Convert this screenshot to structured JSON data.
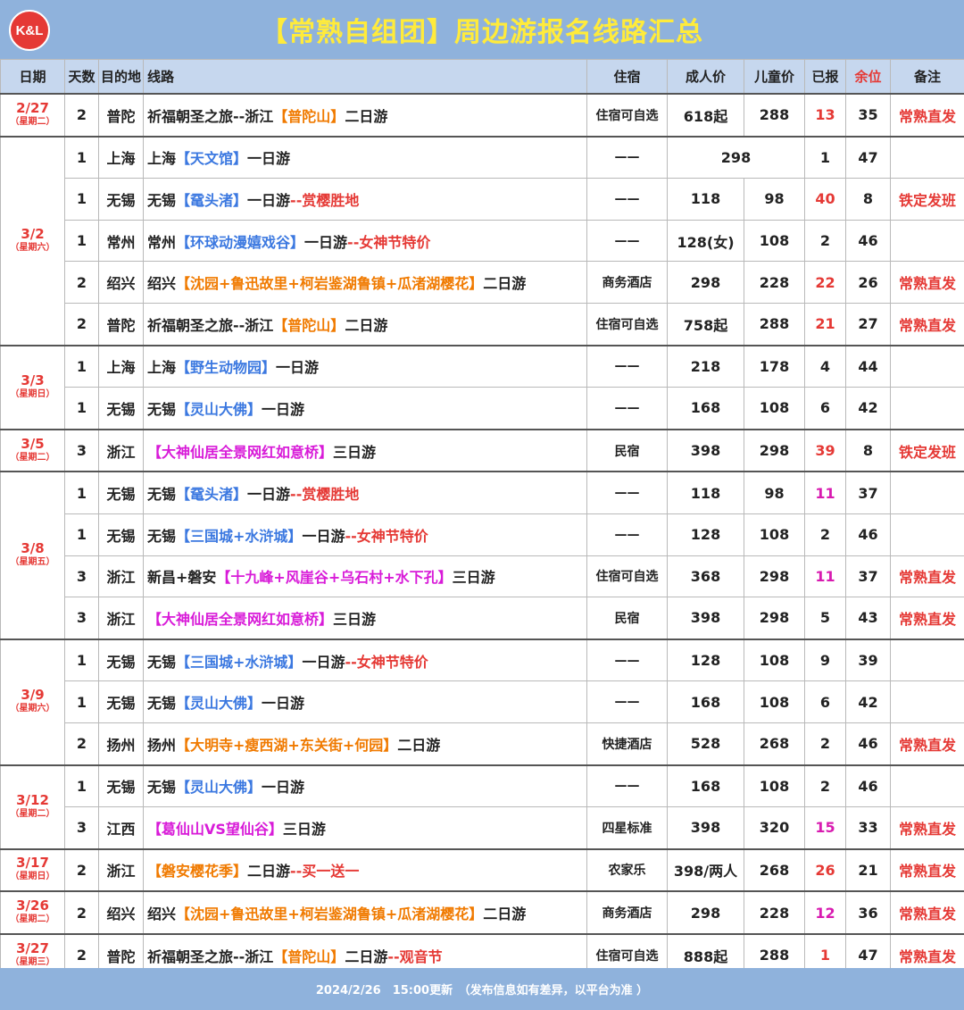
{
  "header": {
    "logo": "K&L",
    "title": "【常熟自组团】周边游报名线路汇总"
  },
  "columns": [
    "日期",
    "天数",
    "目的地",
    "线路",
    "住宿",
    "成人价",
    "儿童价",
    "已报",
    "余位",
    "备注"
  ],
  "groups": [
    {
      "date": "2/27",
      "weekday": "（星期二）",
      "rows": [
        {
          "days": "2",
          "dest": "普陀",
          "route": [
            [
              "d",
              "祈福朝圣之旅--浙江"
            ],
            [
              "o",
              "【普陀山】"
            ],
            [
              "d",
              "二日游"
            ]
          ],
          "lodging": "住宿可自选",
          "adult": "618起",
          "child": "288",
          "reported": "13",
          "rep_color": "red",
          "remain": "35",
          "note": "常熟直发"
        }
      ]
    },
    {
      "date": "3/2",
      "weekday": "（星期六）",
      "rows": [
        {
          "days": "1",
          "dest": "上海",
          "route": [
            [
              "d",
              "上海"
            ],
            [
              "b",
              "【天文馆】"
            ],
            [
              "d",
              "一日游"
            ]
          ],
          "lodging": "——",
          "adult": "298",
          "child": "",
          "merged_price": true,
          "reported": "1",
          "rep_color": "",
          "remain": "47",
          "note": ""
        },
        {
          "days": "1",
          "dest": "无锡",
          "route": [
            [
              "d",
              "无锡"
            ],
            [
              "b",
              "【鼋头渚】"
            ],
            [
              "d",
              "一日游"
            ],
            [
              "r",
              "--赏樱胜地"
            ]
          ],
          "lodging": "——",
          "adult": "118",
          "child": "98",
          "reported": "40",
          "rep_color": "red",
          "remain": "8",
          "note": "铁定发班"
        },
        {
          "days": "1",
          "dest": "常州",
          "route": [
            [
              "d",
              "常州"
            ],
            [
              "b",
              "【环球动漫嬉戏谷】"
            ],
            [
              "d",
              "一日游"
            ],
            [
              "r",
              "--女神节特价"
            ]
          ],
          "lodging": "——",
          "adult": "128(女)",
          "child": "108",
          "reported": "2",
          "rep_color": "",
          "remain": "46",
          "note": ""
        },
        {
          "days": "2",
          "dest": "绍兴",
          "route": [
            [
              "d",
              "绍兴"
            ],
            [
              "o",
              "【沈园+鲁迅故里+柯岩鉴湖鲁镇+瓜渚湖樱花】"
            ],
            [
              "d",
              "二日游"
            ]
          ],
          "lodging": "商务酒店",
          "adult": "298",
          "child": "228",
          "reported": "22",
          "rep_color": "red",
          "remain": "26",
          "note": "常熟直发"
        },
        {
          "days": "2",
          "dest": "普陀",
          "route": [
            [
              "d",
              "祈福朝圣之旅--浙江"
            ],
            [
              "o",
              "【普陀山】"
            ],
            [
              "d",
              "二日游"
            ]
          ],
          "lodging": "住宿可自选",
          "adult": "758起",
          "child": "288",
          "reported": "21",
          "rep_color": "red",
          "remain": "27",
          "note": "常熟直发"
        }
      ]
    },
    {
      "date": "3/3",
      "weekday": "（星期日）",
      "rows": [
        {
          "days": "1",
          "dest": "上海",
          "route": [
            [
              "d",
              "上海"
            ],
            [
              "b",
              "【野生动物园】"
            ],
            [
              "d",
              "一日游"
            ]
          ],
          "lodging": "——",
          "adult": "218",
          "child": "178",
          "reported": "4",
          "rep_color": "",
          "remain": "44",
          "note": ""
        },
        {
          "days": "1",
          "dest": "无锡",
          "route": [
            [
              "d",
              "无锡"
            ],
            [
              "b",
              "【灵山大佛】"
            ],
            [
              "d",
              "一日游"
            ]
          ],
          "lodging": "——",
          "adult": "168",
          "child": "108",
          "reported": "6",
          "rep_color": "",
          "remain": "42",
          "note": ""
        }
      ]
    },
    {
      "date": "3/5",
      "weekday": "（星期二）",
      "rows": [
        {
          "days": "3",
          "dest": "浙江",
          "route": [
            [
              "m",
              "【大神仙居全景网红如意桥】"
            ],
            [
              "d",
              "三日游"
            ]
          ],
          "lodging": "民宿",
          "adult": "398",
          "child": "298",
          "reported": "39",
          "rep_color": "red",
          "remain": "8",
          "note": "铁定发班"
        }
      ]
    },
    {
      "date": "3/8",
      "weekday": "（星期五）",
      "rows": [
        {
          "days": "1",
          "dest": "无锡",
          "route": [
            [
              "d",
              "无锡"
            ],
            [
              "b",
              "【鼋头渚】"
            ],
            [
              "d",
              "一日游"
            ],
            [
              "r",
              "--赏樱胜地"
            ]
          ],
          "lodging": "——",
          "adult": "118",
          "child": "98",
          "reported": "11",
          "rep_color": "magenta",
          "remain": "37",
          "note": ""
        },
        {
          "days": "1",
          "dest": "无锡",
          "route": [
            [
              "d",
              "无锡"
            ],
            [
              "b",
              "【三国城+水浒城】"
            ],
            [
              "d",
              "一日游"
            ],
            [
              "r",
              "--女神节特价"
            ]
          ],
          "lodging": "——",
          "adult": "128",
          "child": "108",
          "reported": "2",
          "rep_color": "",
          "remain": "46",
          "note": ""
        },
        {
          "days": "3",
          "dest": "浙江",
          "route": [
            [
              "d",
              "新昌+磐安"
            ],
            [
              "m",
              "【十九峰+风崖谷+乌石村+水下孔】"
            ],
            [
              "d",
              "三日游"
            ]
          ],
          "lodging": "住宿可自选",
          "adult": "368",
          "child": "298",
          "reported": "11",
          "rep_color": "magenta",
          "remain": "37",
          "note": "常熟直发"
        },
        {
          "days": "3",
          "dest": "浙江",
          "route": [
            [
              "m",
              "【大神仙居全景网红如意桥】"
            ],
            [
              "d",
              "三日游"
            ]
          ],
          "lodging": "民宿",
          "adult": "398",
          "child": "298",
          "reported": "5",
          "rep_color": "",
          "remain": "43",
          "note": "常熟直发"
        }
      ]
    },
    {
      "date": "3/9",
      "weekday": "（星期六）",
      "rows": [
        {
          "days": "1",
          "dest": "无锡",
          "route": [
            [
              "d",
              "无锡"
            ],
            [
              "b",
              "【三国城+水浒城】"
            ],
            [
              "d",
              "一日游"
            ],
            [
              "r",
              "--女神节特价"
            ]
          ],
          "lodging": "——",
          "adult": "128",
          "child": "108",
          "reported": "9",
          "rep_color": "",
          "remain": "39",
          "note": ""
        },
        {
          "days": "1",
          "dest": "无锡",
          "route": [
            [
              "d",
              "无锡"
            ],
            [
              "b",
              "【灵山大佛】"
            ],
            [
              "d",
              "一日游"
            ]
          ],
          "lodging": "——",
          "adult": "168",
          "child": "108",
          "reported": "6",
          "rep_color": "",
          "remain": "42",
          "note": ""
        },
        {
          "days": "2",
          "dest": "扬州",
          "route": [
            [
              "d",
              "扬州"
            ],
            [
              "o",
              "【大明寺+瘦西湖+东关街+何园】"
            ],
            [
              "d",
              "二日游"
            ]
          ],
          "lodging": "快捷酒店",
          "adult": "528",
          "child": "268",
          "reported": "2",
          "rep_color": "",
          "remain": "46",
          "note": "常熟直发"
        }
      ]
    },
    {
      "date": "3/12",
      "weekday": "（星期二）",
      "rows": [
        {
          "days": "1",
          "dest": "无锡",
          "route": [
            [
              "d",
              "无锡"
            ],
            [
              "b",
              "【灵山大佛】"
            ],
            [
              "d",
              "一日游"
            ]
          ],
          "lodging": "——",
          "adult": "168",
          "child": "108",
          "reported": "2",
          "rep_color": "",
          "remain": "46",
          "note": ""
        },
        {
          "days": "3",
          "dest": "江西",
          "route": [
            [
              "m",
              "【葛仙山VS望仙谷】"
            ],
            [
              "d",
              "三日游"
            ]
          ],
          "lodging": "四星标准",
          "adult": "398",
          "child": "320",
          "reported": "15",
          "rep_color": "magenta",
          "remain": "33",
          "note": "常熟直发"
        }
      ]
    },
    {
      "date": "3/17",
      "weekday": "（星期日）",
      "rows": [
        {
          "days": "2",
          "dest": "浙江",
          "route": [
            [
              "o",
              "【磐安樱花季】"
            ],
            [
              "d",
              "二日游"
            ],
            [
              "r",
              "--买一送一"
            ]
          ],
          "lodging": "农家乐",
          "adult": "398/两人",
          "child": "268",
          "reported": "26",
          "rep_color": "red",
          "remain": "21",
          "note": "常熟直发"
        }
      ]
    },
    {
      "date": "3/26",
      "weekday": "（星期二）",
      "rows": [
        {
          "days": "2",
          "dest": "绍兴",
          "route": [
            [
              "d",
              "绍兴"
            ],
            [
              "o",
              "【沈园+鲁迅故里+柯岩鉴湖鲁镇+瓜渚湖樱花】"
            ],
            [
              "d",
              "二日游"
            ]
          ],
          "lodging": "商务酒店",
          "adult": "298",
          "child": "228",
          "reported": "12",
          "rep_color": "magenta",
          "remain": "36",
          "note": "常熟直发"
        }
      ]
    },
    {
      "date": "3/27",
      "weekday": "（星期三）",
      "rows": [
        {
          "days": "2",
          "dest": "普陀",
          "route": [
            [
              "d",
              "祈福朝圣之旅--浙江"
            ],
            [
              "o",
              "【普陀山】"
            ],
            [
              "d",
              "二日游"
            ],
            [
              "r",
              "--观音节"
            ]
          ],
          "lodging": "住宿可自选",
          "adult": "888起",
          "child": "288",
          "reported": "1",
          "rep_color": "red",
          "remain": "47",
          "note": "常熟直发"
        }
      ]
    }
  ],
  "footer": "2024/2/26　15:00更新　（发布信息如有差异，以平台为准 ）",
  "colors": {
    "header_bg": "#8fb2dc",
    "title": "#ffeb3b",
    "accent_red": "#e53935",
    "blue": "#3b78e0",
    "orange": "#f07a00",
    "magenta": "#d81bd8"
  }
}
